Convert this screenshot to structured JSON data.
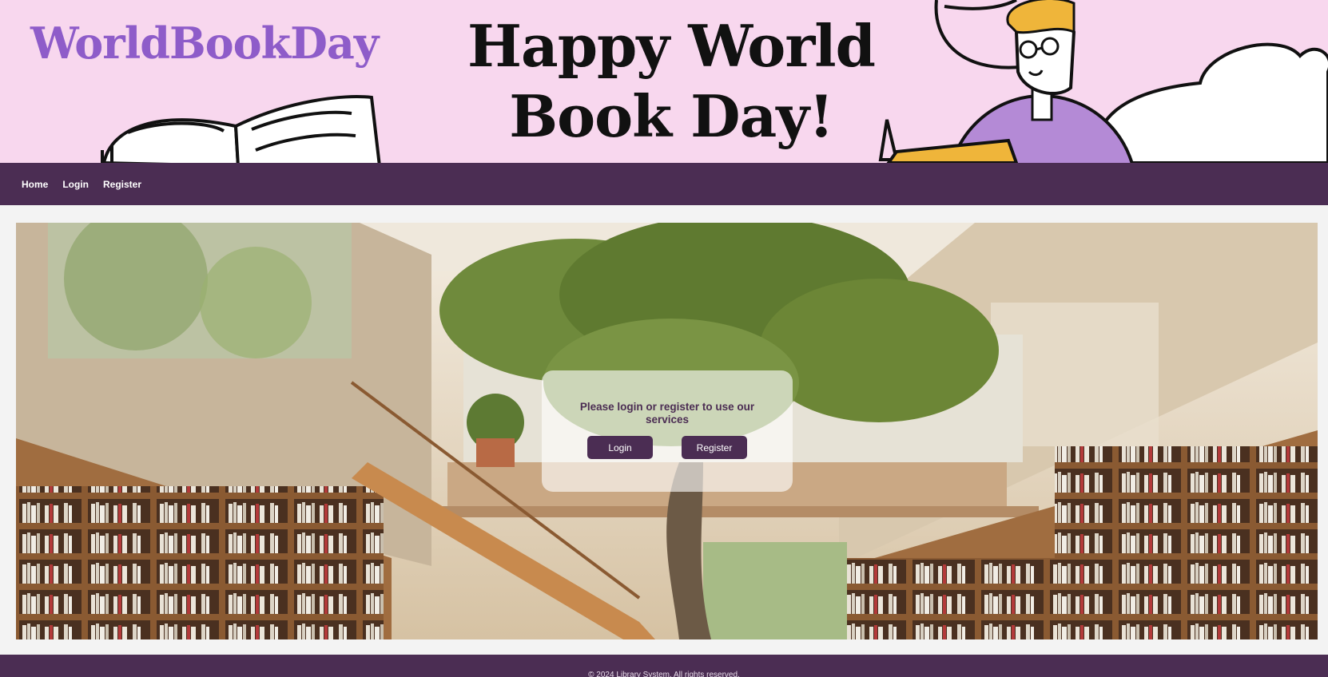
{
  "banner": {
    "brand": "WorldBookDay",
    "headline_line1": "Happy World",
    "headline_line2": "Book Day!"
  },
  "nav": {
    "items": [
      "Home",
      "Login",
      "Register"
    ]
  },
  "hero": {
    "message": "Please login or register to use our services",
    "login_label": "Login",
    "register_label": "Register"
  },
  "footer": {
    "text": "© 2024 Library System. All rights reserved."
  },
  "colors": {
    "brand": "#8e5cc9",
    "primary": "#4b2d53",
    "banner_bg": "#f8d7ee"
  }
}
